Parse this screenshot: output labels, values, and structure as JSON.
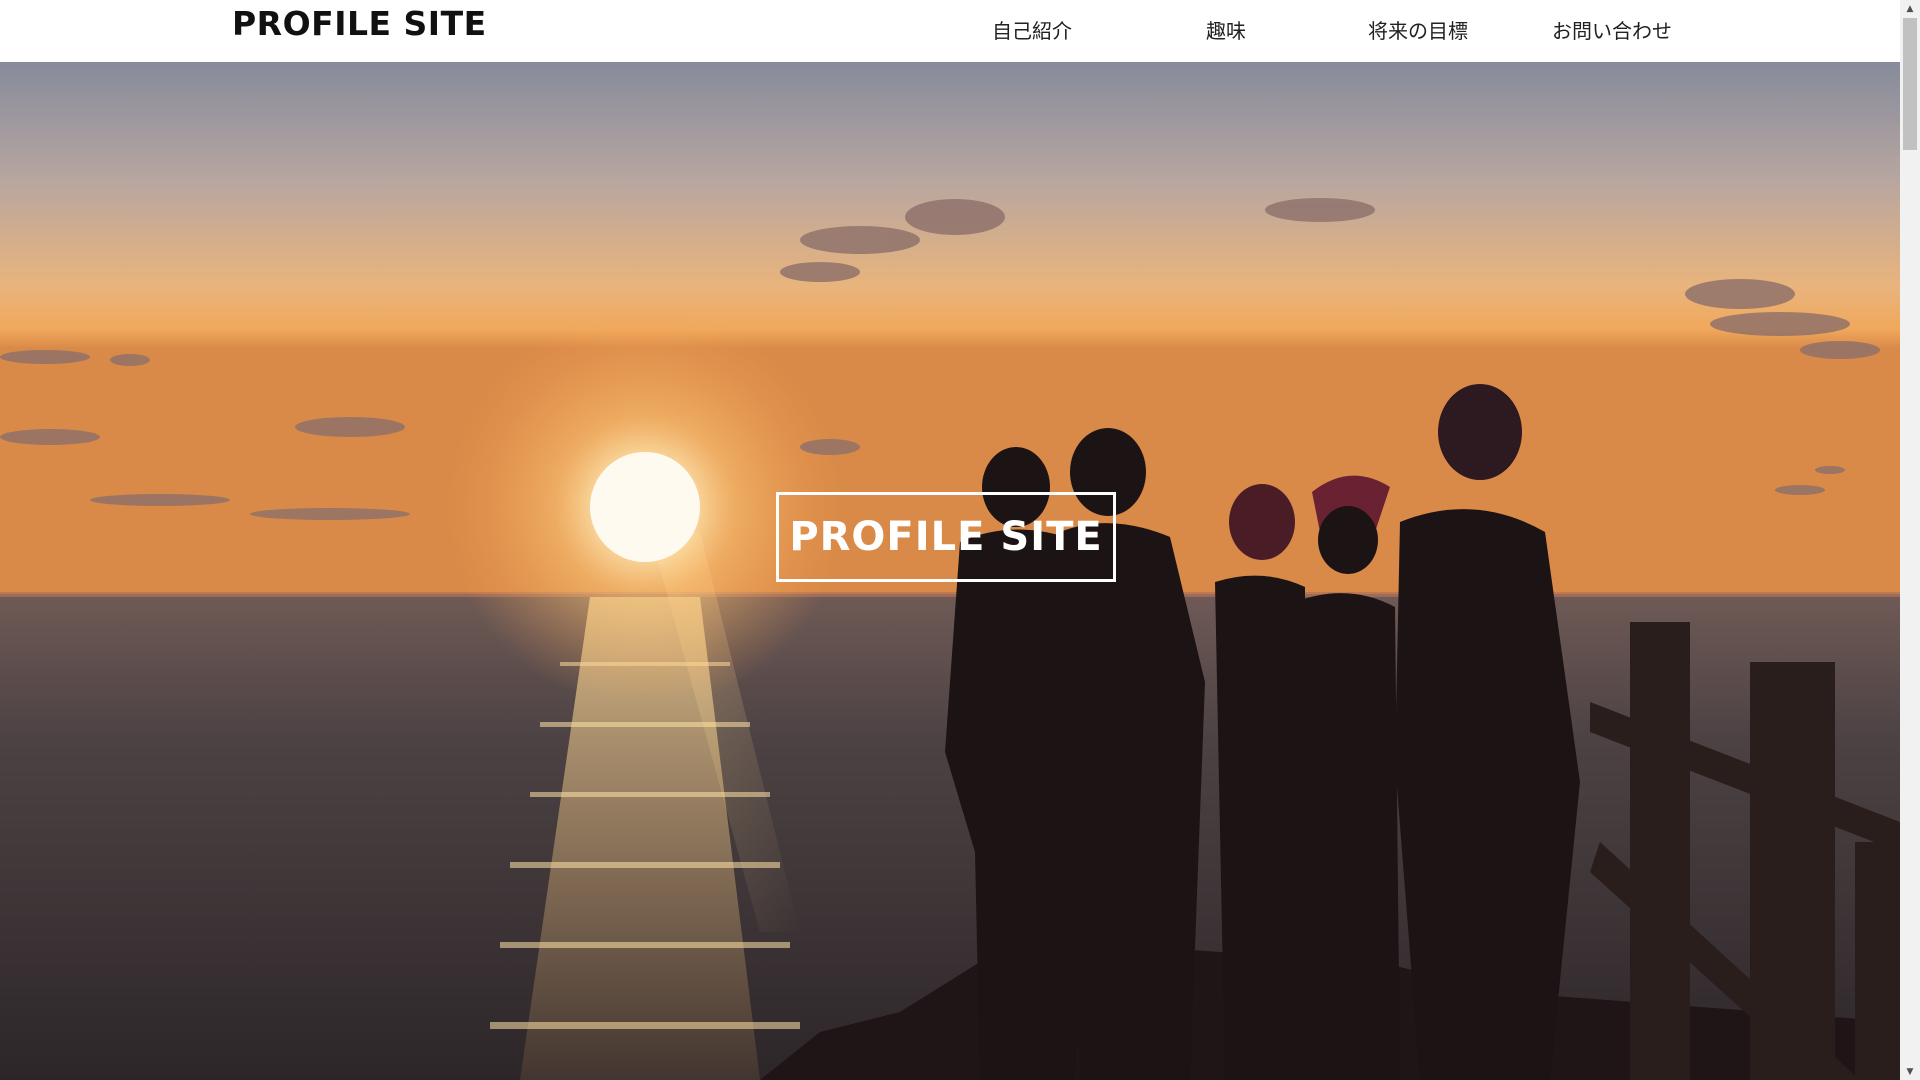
{
  "site": {
    "logo": "PROFILE SITE"
  },
  "nav": {
    "items": [
      {
        "label": "自己紹介"
      },
      {
        "label": "趣味"
      },
      {
        "label": "将来の目標"
      },
      {
        "label": "お問い合わせ"
      }
    ]
  },
  "hero": {
    "title": "PROFILE SITE",
    "image_subject": "sunset over the sea with silhouetted group of people on a cliff",
    "colors": {
      "sky_top": "#8a8fa0",
      "sky_glow": "#f3b36a",
      "sun": "#fff6d8",
      "sea": "#3c3436",
      "silhouette": "#1b1214"
    }
  },
  "icons": {
    "scroll_up": "triangle-up-icon",
    "scroll_down": "triangle-down-icon"
  }
}
